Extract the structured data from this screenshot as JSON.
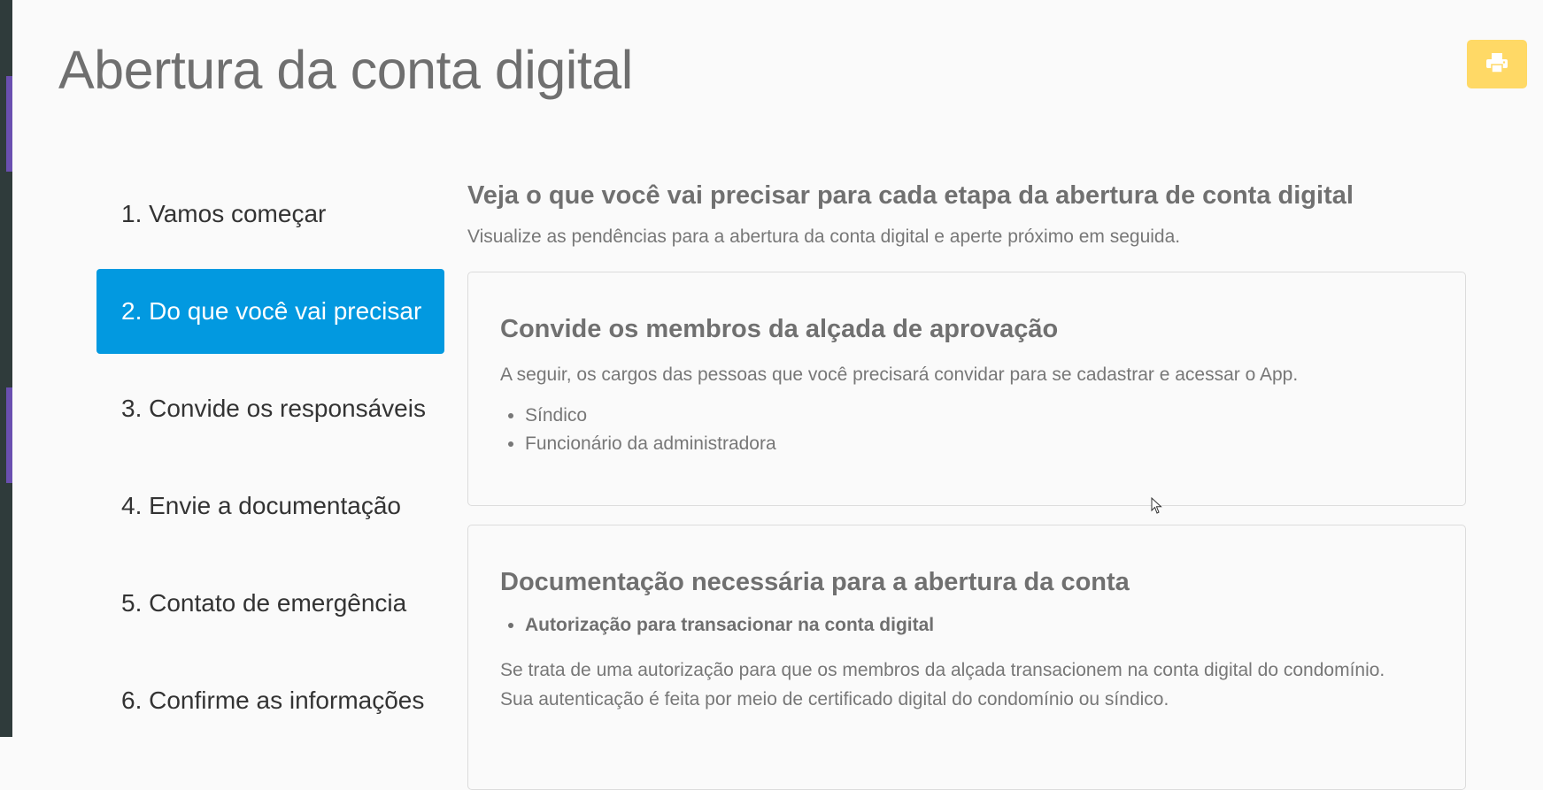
{
  "page": {
    "title": "Abertura da conta digital"
  },
  "toolbar": {
    "print_icon": "printer-icon"
  },
  "steps": [
    {
      "label": "1. Vamos começar",
      "active": false
    },
    {
      "label": "2. Do que você vai precisar",
      "active": true
    },
    {
      "label": "3. Convide os responsáveis",
      "active": false
    },
    {
      "label": "4. Envie a documentação",
      "active": false
    },
    {
      "label": "5. Contato de emergência",
      "active": false
    },
    {
      "label": "6. Confirme as informações",
      "active": false
    }
  ],
  "main": {
    "heading": "Veja o que você vai precisar para cada etapa da abertura de conta digital",
    "subheading": "Visualize as pendências para a abertura da conta digital e aperte próximo em seguida.",
    "cards": [
      {
        "title": "Convide os membros da alçada de aprovação",
        "text": "A seguir, os cargos das pessoas que você precisará convidar para se cadastrar e acessar o App.",
        "items": [
          "Síndico",
          "Funcionário da administradora"
        ]
      },
      {
        "title": "Documentação necessária para a abertura da conta",
        "items": [
          "Autorização para transacionar na conta digital"
        ],
        "text_lines": [
          "Se trata de uma autorização para que os membros da alçada transacionem na conta digital do condomínio.",
          "Sua autenticação é feita por meio de certificado digital do condomínio ou síndico."
        ]
      }
    ]
  },
  "colors": {
    "accent": "#0299e0",
    "print_button": "#ffd966",
    "sidebar_mark": "#6a4fb0"
  }
}
